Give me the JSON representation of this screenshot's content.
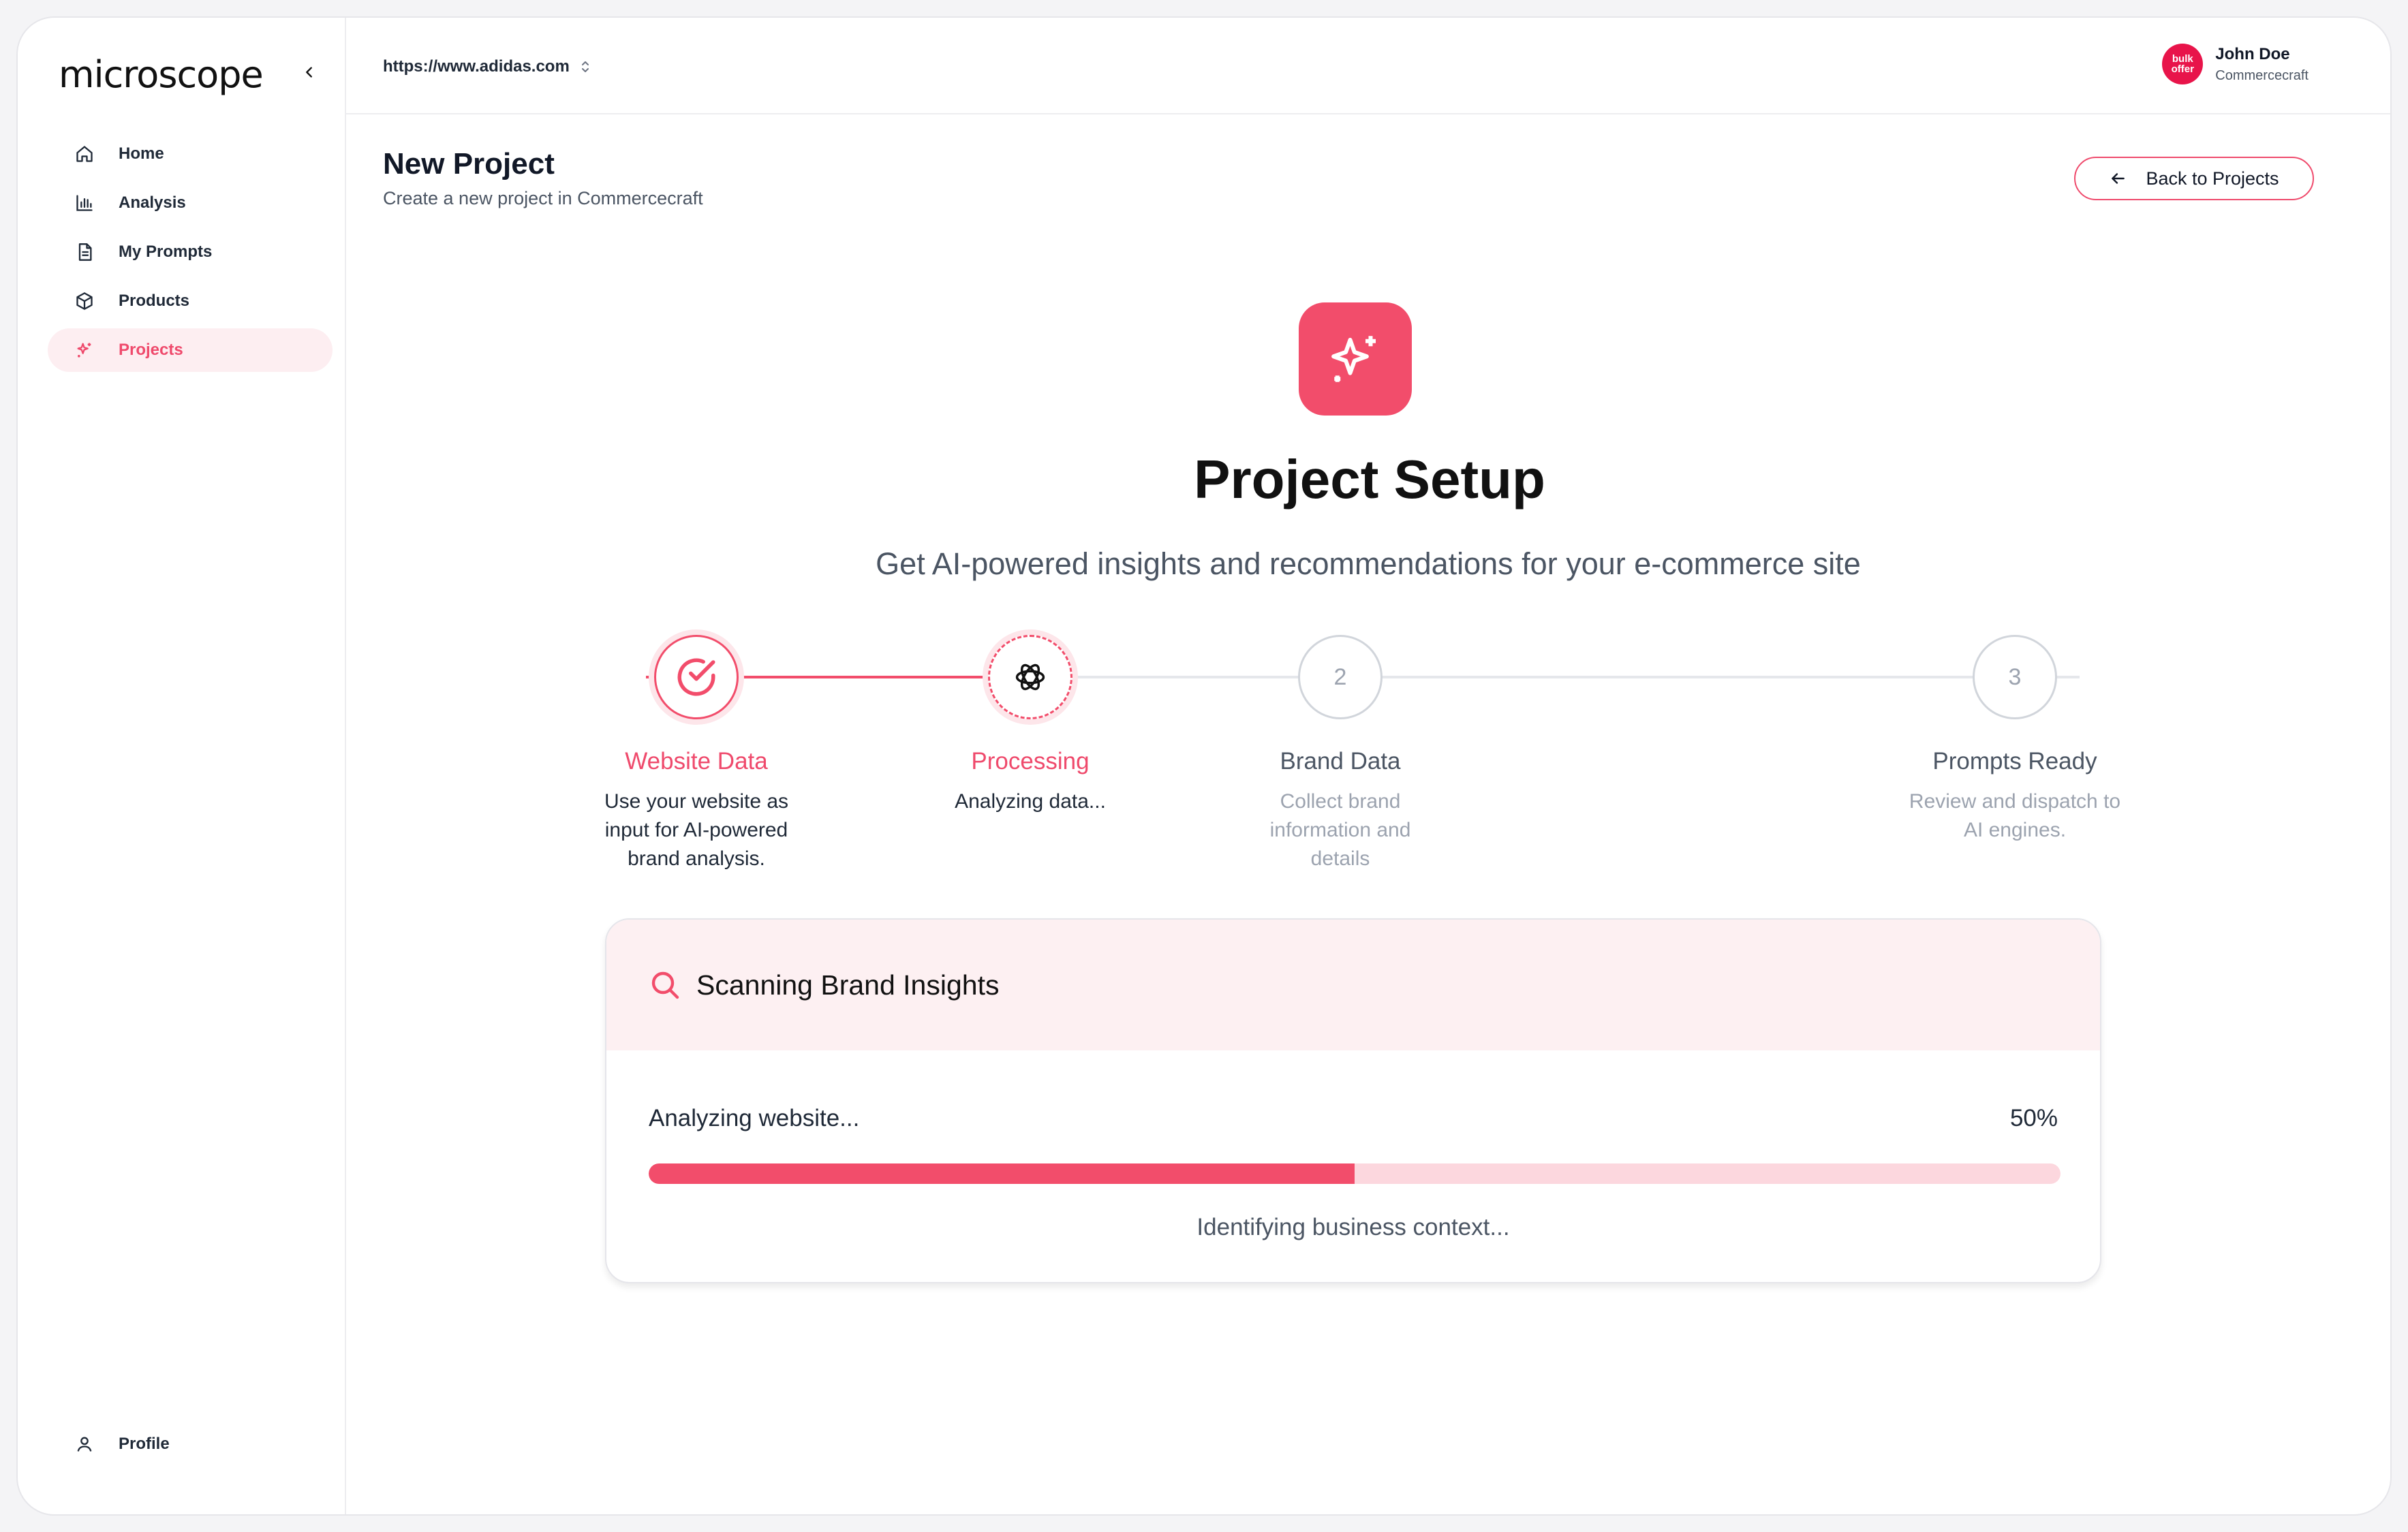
{
  "app": {
    "logo": "microscope",
    "url": "https://www.adidas.com"
  },
  "sidebar": {
    "items": [
      {
        "label": "Home",
        "icon": "home-icon",
        "active": false
      },
      {
        "label": "Analysis",
        "icon": "bar-chart-icon",
        "active": false
      },
      {
        "label": "My Prompts",
        "icon": "document-icon",
        "active": false
      },
      {
        "label": "Products",
        "icon": "box-icon",
        "active": false
      },
      {
        "label": "Projects",
        "icon": "sparkle-icon",
        "active": true
      }
    ],
    "profile_label": "Profile"
  },
  "user": {
    "name": "John Doe",
    "org": "Commercecraft",
    "avatar_line1": "bulk",
    "avatar_line2": "offer"
  },
  "page": {
    "title": "New Project",
    "subtitle": "Create a new project in Commercecraft",
    "back_label": "Back to Projects"
  },
  "hero": {
    "title": "Project Setup",
    "subtitle": "Get AI-powered insights and recommendations for your e-commerce site"
  },
  "steps": [
    {
      "title": "Website Data",
      "desc": "Use your website as input for AI-powered brand analysis.",
      "state": "done"
    },
    {
      "title": "Processing",
      "desc": "Analyzing data...",
      "state": "current"
    },
    {
      "title": "Brand Data",
      "desc": "Collect brand information and details",
      "number": "2",
      "state": "upcoming"
    },
    {
      "title": "Prompts Ready",
      "desc": "Review and dispatch to AI engines.",
      "number": "3",
      "state": "upcoming"
    }
  ],
  "scan_card": {
    "title": "Scanning Brand Insights",
    "progress_label": "Analyzing website...",
    "progress_percent_text": "50%",
    "progress_value": 0.5,
    "detail": "Identifying business context..."
  },
  "colors": {
    "accent": "#f24d6b",
    "accent_light": "#fcd7de",
    "accent_bg": "#fdf0f2",
    "muted": "#9ca3af"
  }
}
